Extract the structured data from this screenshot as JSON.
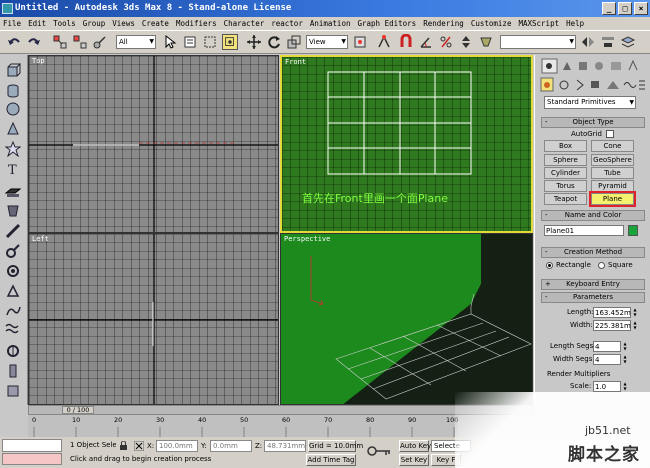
{
  "window": {
    "title": "Untitled - Autodesk 3ds Max 8 - Stand-alone License",
    "controls": [
      "_",
      "□",
      "×"
    ]
  },
  "menu": [
    "File",
    "Edit",
    "Tools",
    "Group",
    "Views",
    "Create",
    "Modifiers",
    "Character",
    "reactor",
    "Animation",
    "Graph Editors",
    "Rendering",
    "Customize",
    "MAXScript",
    "Help"
  ],
  "toolbar": {
    "selection_filter": "All",
    "ref_coord": "View"
  },
  "viewports": {
    "top_label": "Top",
    "front_label": "Front",
    "left_label": "Left",
    "perspective_label": "Perspective",
    "caption": "首先在Front里画一个面Plane"
  },
  "command_panel": {
    "category_dropdown": "Standard Primitives",
    "object_type": {
      "header": "Object Type",
      "autogrid_label": "AutoGrid",
      "buttons": [
        "Box",
        "Cone",
        "Sphere",
        "GeoSphere",
        "Cylinder",
        "Tube",
        "Torus",
        "Pyramid",
        "Teapot",
        "Plane"
      ],
      "selected": "Plane"
    },
    "name_color": {
      "header": "Name and Color",
      "name_value": "Plane01",
      "color": "#1aa33a"
    },
    "creation_method": {
      "header": "Creation Method",
      "options": [
        "Rectangle",
        "Square"
      ],
      "selected": "Rectangle"
    },
    "keyboard_entry_header": "Keyboard Entry",
    "parameters": {
      "header": "Parameters",
      "length_label": "Length:",
      "length_value": "163.452m",
      "width_label": "Width:",
      "width_value": "225.381m",
      "length_segs_label": "Length Segs:",
      "length_segs_value": "4",
      "width_segs_label": "Width Segs:",
      "width_segs_value": "4",
      "render_multipliers_label": "Render Multipliers",
      "scale_label": "Scale:",
      "scale_value": "1.0"
    }
  },
  "timeline": {
    "slider_label": "0 / 100",
    "ticks": [
      "0",
      "10",
      "20",
      "30",
      "40",
      "50",
      "60",
      "70",
      "80",
      "90",
      "100"
    ]
  },
  "status": {
    "selection": "1 Object Sele",
    "x_label": "X:",
    "x_value": "100.0mm",
    "y_label": "Y:",
    "y_value": "0.0mm",
    "z_label": "Z:",
    "z_value": "48.731mm",
    "grid": "Grid = 10.0mm",
    "prompt": "Click and drag to begin creation process",
    "add_time_tag": "Add Time Tag",
    "auto_key": "Auto Key",
    "selected_dropdown": "Selecte",
    "set_key": "Set Key",
    "key_filters": "Key F"
  },
  "watermark": {
    "url": "jb51.net",
    "site_name": "脚本之家"
  }
}
